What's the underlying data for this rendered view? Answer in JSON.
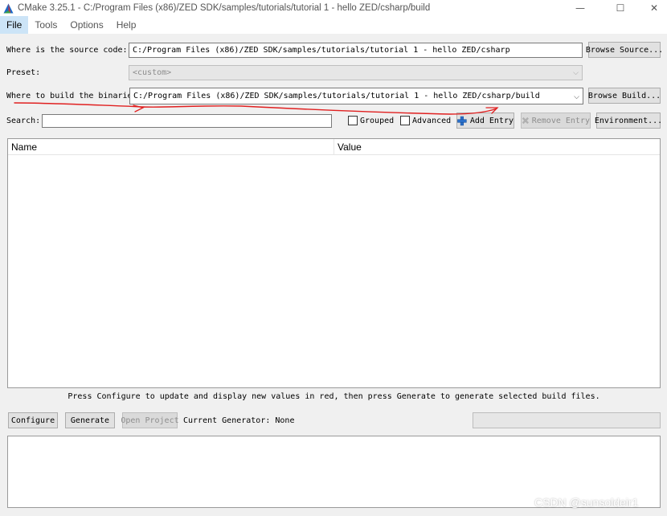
{
  "window": {
    "title": "CMake 3.25.1 - C:/Program Files (x86)/ZED SDK/samples/tutorials/tutorial 1 - hello ZED/csharp/build",
    "minimize_glyph": "—",
    "maximize_glyph": "☐",
    "close_glyph": "✕",
    "logo_icon": "cmake-triangle-icon"
  },
  "menu": [
    "File",
    "Tools",
    "Options",
    "Help"
  ],
  "source": {
    "label": "Where is the source code:",
    "value": "C:/Program Files (x86)/ZED SDK/samples/tutorials/tutorial 1 - hello ZED/csharp",
    "browse_label": "Browse Source..."
  },
  "preset": {
    "label": "Preset:",
    "value": "<custom>"
  },
  "binaries": {
    "label": "Where to build the binaries:",
    "value": "C:/Program Files (x86)/ZED SDK/samples/tutorials/tutorial 1 - hello ZED/csharp/build",
    "browse_label": "Browse Build..."
  },
  "search": {
    "label": "Search:",
    "value": ""
  },
  "options": {
    "grouped_label": "Grouped",
    "advanced_label": "Advanced",
    "add_entry_label": "Add Entry",
    "remove_entry_label": "Remove Entry",
    "environment_label": "Environment..."
  },
  "table": {
    "columns": [
      "Name",
      "Value"
    ]
  },
  "hint": "Press Configure to update and display new values in red, then press Generate to generate selected build files.",
  "bottom": {
    "configure_label": "Configure",
    "generate_label": "Generate",
    "open_project_label": "Open Project",
    "current_generator": "Current Generator: None"
  },
  "watermark": "CSDN @sunsoldeir1",
  "colors": {
    "annotation": "#e02020",
    "add_icon": "#2a6fc9"
  }
}
